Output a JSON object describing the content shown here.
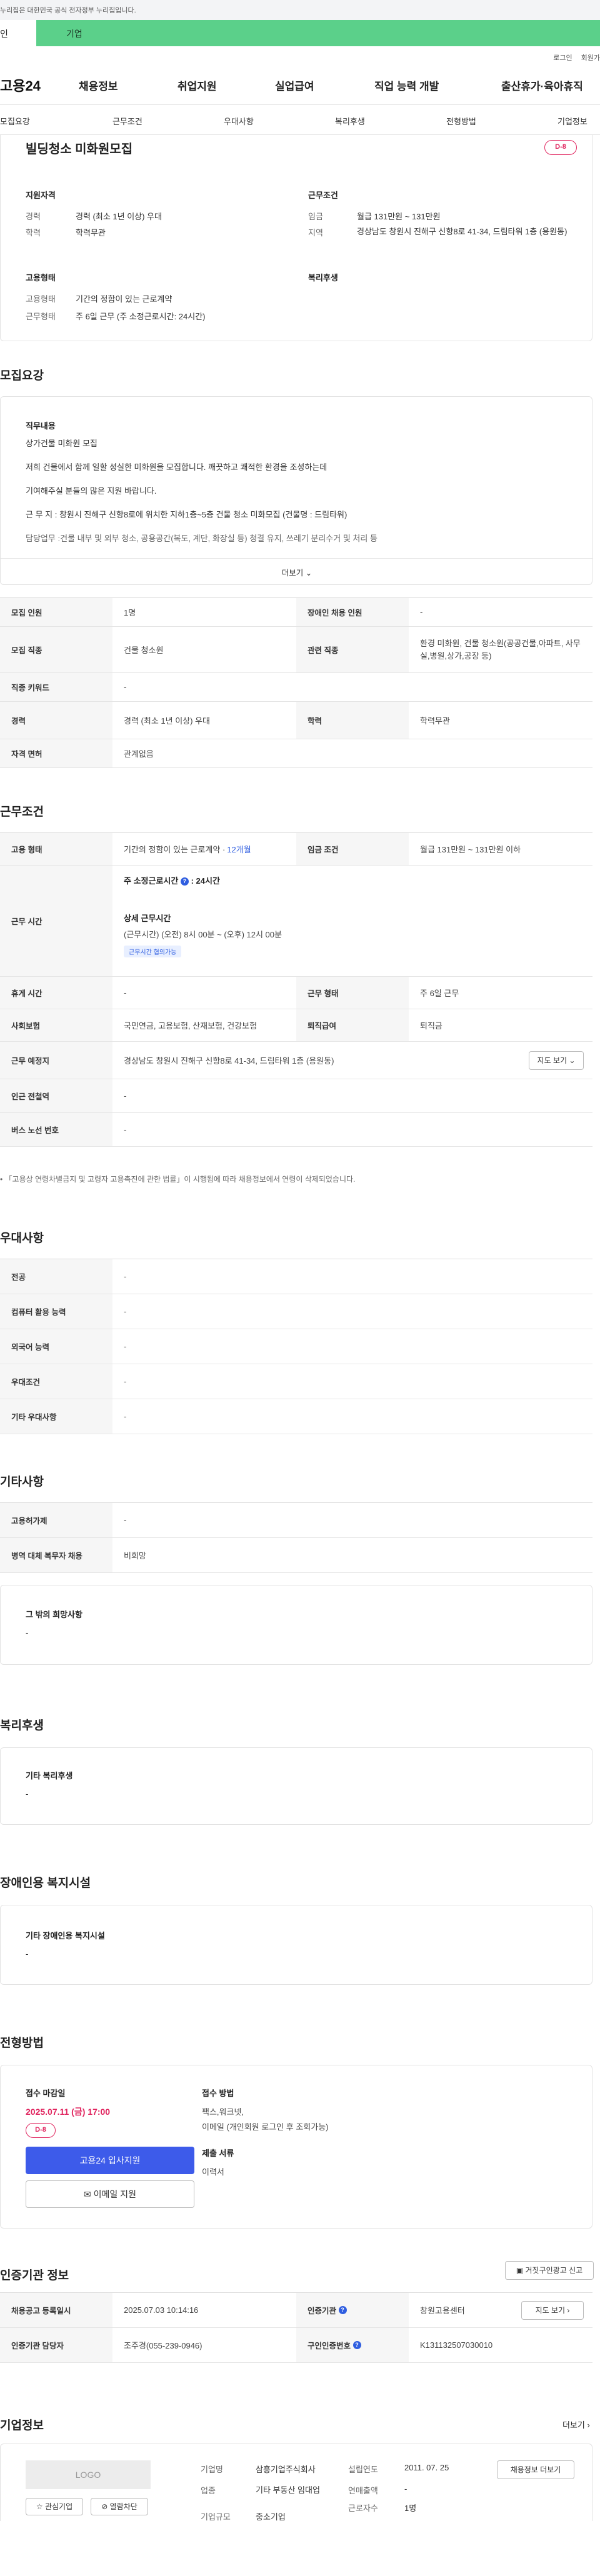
{
  "top": {
    "notice": "누리집은 대한민국 공식 전자정부 누리집입니다.",
    "tab_individual": "인",
    "tab_corp": "기업",
    "login": "로그인",
    "signup": "회원가"
  },
  "gnb": {
    "logo": "고용24",
    "items": [
      "채용정보",
      "취업지원",
      "실업급여",
      "직업 능력 개발",
      "출산휴가·육아휴직"
    ]
  },
  "anchors": [
    "모집요강",
    "근무조건",
    "우대사항",
    "복리후생",
    "전형방법",
    "기업정보"
  ],
  "summary": {
    "title": "빌딩청소 미화원모집",
    "dday": "D-8",
    "qual_label": "지원자격",
    "qual": [
      {
        "k": "경력",
        "v": "경력 (최소 1년 이상) 우대"
      },
      {
        "k": "학력",
        "v": "학력무관"
      }
    ],
    "cond_label": "근무조건",
    "cond": [
      {
        "k": "임금",
        "v": "월급 131만원 ~ 131만원"
      },
      {
        "k": "지역",
        "v": "경상남도 창원시 진해구 신항8로 41-34, 드림타워 1층 (용원동)"
      }
    ],
    "emp_label": "고용형태",
    "emp": [
      {
        "k": "고용형태",
        "v": "기간의 정함이 있는 근로계약"
      },
      {
        "k": "근무형태",
        "v": "주 6일 근무 (주 소정근로시간: 24시간)"
      }
    ],
    "welfare_label": "복리후생"
  },
  "recruit": {
    "heading": "모집요강",
    "duty_label": "직무내용",
    "lines": [
      "상가건물 미화원 모집",
      "저희 건물에서 함께 일할 성실한 미화원을 모집합니다. 깨끗하고 쾌적한 환경을 조성하는데",
      "기여해주실 분들의 많은 지원 바랍니다.",
      "근 무 지 : 창원시 진해구 신항8로에 위치한 지하1층~5층 건물 청소 미화모집 (건물명 : 드림타워)",
      "담당업무 :건물 내부 및 외부 청소, 공용공간(복도, 계단, 화장실 등) 청결 유지, 쓰레기 분리수거 및 처리 등"
    ],
    "more": "더보기",
    "table": [
      [
        {
          "th": "모집 인원",
          "td": "1명"
        },
        {
          "th": "장애인 채용 인원",
          "td": "-"
        }
      ],
      [
        {
          "th": "모집 직종",
          "td": "건물 청소원"
        },
        {
          "th": "관련 직종",
          "td": "환경 미화원, 건물 청소원(공공건물,아파트, 사무실,병원,상가,공장 등)"
        }
      ],
      [
        {
          "th": "직종 키워드",
          "td": "-"
        }
      ],
      [
        {
          "th": "경력",
          "td": "경력 (최소 1년 이상) 우대"
        },
        {
          "th": "학력",
          "td": "학력무관"
        }
      ],
      [
        {
          "th": "자격 면허",
          "td": "관계없음"
        }
      ]
    ]
  },
  "work": {
    "heading": "근무조건",
    "employ_type_th": "고용 형태",
    "employ_type_td": "기간의 정함이 있는 근로계약 · ",
    "employ_period": "12개월",
    "wage_th": "임금 조건",
    "wage_td": "월급 131만원 ~ 131만원 이하",
    "hours_th": "근무 시간",
    "hours_main": "주 소정근로시간",
    "hours_val": ": 24시간",
    "detail_label": "상세 근무시간",
    "detail_text": "(근무시간) (오전) 8시 00분 ~ (오후) 12시 00분",
    "detail_badge": "근무시간 협의가능",
    "rest_th": "휴게 시간",
    "rest_td": "-",
    "shift_th": "근무 형태",
    "shift_td": "주 6일 근무",
    "ins_th": "사회보험",
    "ins_td": "국민연금, 고용보험, 산재보험, 건강보험",
    "ret_th": "퇴직급여",
    "ret_td": "퇴직금",
    "place_th": "근무 예정지",
    "place_td": "경상남도 창원시 진해구 신항8로 41-34, 드림타워 1층 (용원동)",
    "map_btn": "지도 보기",
    "subway_th": "인근 전철역",
    "subway_td": "-",
    "bus_th": "버스 노선 번호",
    "bus_td": "-",
    "footnote": "「고용상 연령차별금지 및 고령자 고용촉진에 관한 법률」이 시행됨에 따라 채용정보에서 연령이 삭제되었습니다."
  },
  "pref": {
    "heading": "우대사항",
    "rows": [
      {
        "th": "전공",
        "td": "-"
      },
      {
        "th": "컴퓨터 활용 능력",
        "td": "-"
      },
      {
        "th": "외국어 능력",
        "td": "-"
      },
      {
        "th": "우대조건",
        "td": "-"
      },
      {
        "th": "기타 우대사항",
        "td": "-"
      }
    ]
  },
  "other": {
    "heading": "기타사항",
    "rows": [
      {
        "th": "고용허가제",
        "td": "-"
      },
      {
        "th": "병역 대체 복무자 채용",
        "td": "비희망"
      }
    ],
    "box_title": "그 밖의 희망사항",
    "box_val": "-"
  },
  "welfare": {
    "heading": "복리후생",
    "box_title": "기타 복리후생",
    "box_val": "-"
  },
  "disabled": {
    "heading": "장애인용 복지시설",
    "box_title": "기타 장애인용 복지시설",
    "box_val": "-"
  },
  "process": {
    "heading": "전형방법",
    "deadline_label": "접수 마감일",
    "deadline": "2025.07.11 (금) 17:00",
    "dday": "D-8",
    "apply_btn": "고용24 입사지원",
    "email_btn": "이메일 지원",
    "method_label": "접수 방법",
    "method_lines": [
      "팩스,워크넷,",
      "이메일 (개인회원 로그인 후 조회가능)"
    ],
    "docs_label": "제출 서류",
    "docs": "이력서"
  },
  "cert": {
    "heading": "인증기관 정보",
    "report_btn": "거짓구인광고 신고",
    "r1": [
      {
        "th": "채용공고 등록일시",
        "td": "2025.07.03 10:14:16"
      },
      {
        "th": "인증기관",
        "td": "창원고용센터"
      }
    ],
    "map_btn": "지도 보기",
    "r2": [
      {
        "th": "인증기관 담당자",
        "td": "조주경(055-239-0946)"
      },
      {
        "th": "구인인증번호",
        "td": "K131132507030010"
      }
    ]
  },
  "company": {
    "heading": "기업정보",
    "more": "더보기",
    "logo": "LOGO",
    "interest": "관심기업",
    "hide": "열람차단",
    "name_k": "기업명",
    "name_v": "삼흥기업주식회사",
    "ind_k": "업종",
    "ind_v": "기타 부동산 임대업",
    "size_k": "기업규모",
    "size_v": "중소기업",
    "est_k": "설립연도",
    "est_v": "2011. 07. 25",
    "sales_k": "연매출액",
    "sales_v": "-",
    "emp_k": "근로자수",
    "emp_v": "1명",
    "jobs_btn": "채용정보 더보기"
  }
}
